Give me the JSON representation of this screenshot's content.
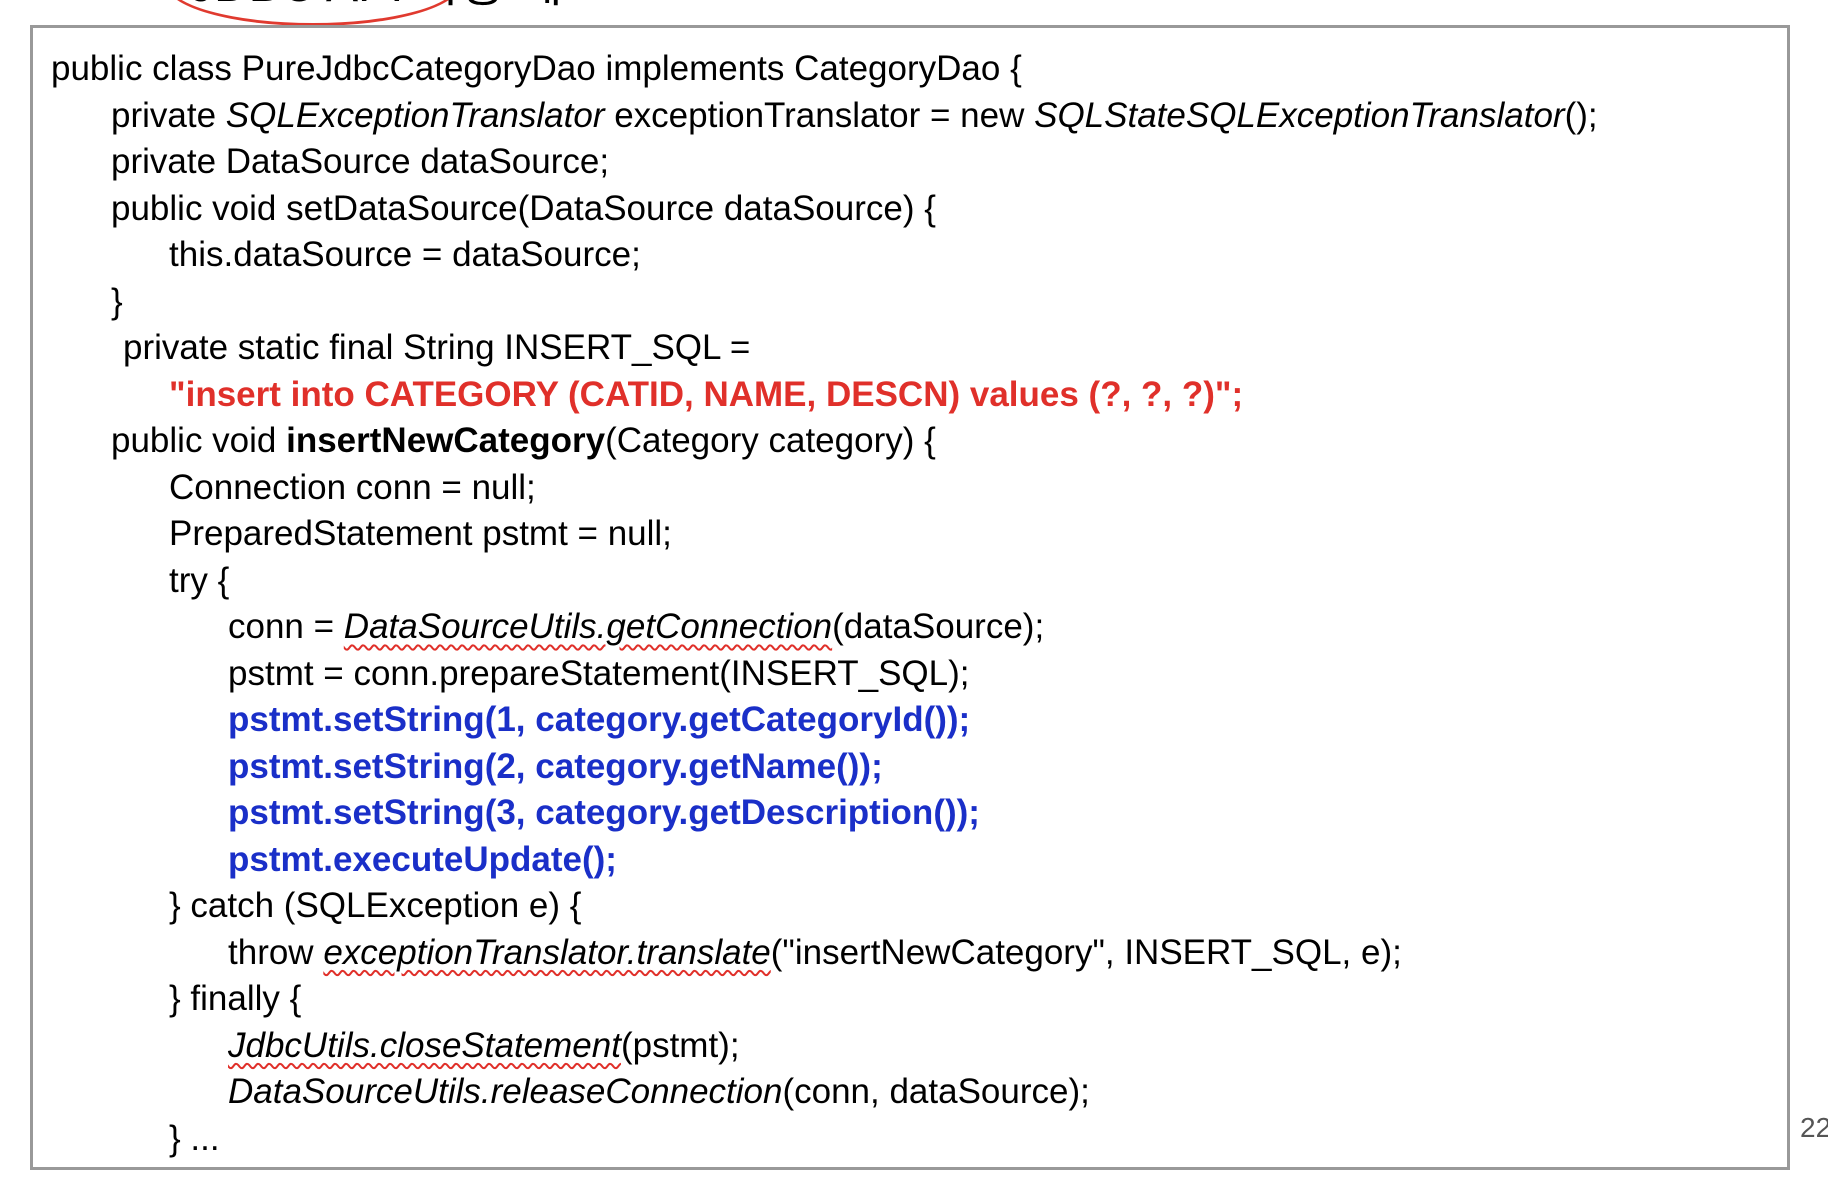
{
  "slide": {
    "title": "JDBC API 사용 예",
    "page_number": "22"
  },
  "code": {
    "l1": "public class PureJdbcCategoryDao implements CategoryDao {",
    "l2_a": "private ",
    "l2_b": "SQLExceptionTranslator",
    "l2_c": " exceptionTranslator = new ",
    "l2_d": "SQLStateSQLExceptionTranslator",
    "l2_e": "();",
    "l3": "private DataSource dataSource;",
    "l4": "public void setDataSource(DataSource dataSource) {",
    "l5": "this.dataSource = dataSource;",
    "l6": "}",
    "l7": "private static final String INSERT_SQL =",
    "l8": "\"insert into CATEGORY (CATID, NAME, DESCN) values (?, ?, ?)\";",
    "l9_a": "public void ",
    "l9_b": "insertNewCategory",
    "l9_c": "(Category category) {",
    "l10": "Connection conn = null;",
    "l11": "PreparedStatement pstmt = null;",
    "l12": "try {",
    "l13_a": "conn = ",
    "l13_b": "DataSourceUtils.getConnection",
    "l13_c": "(dataSource);",
    "l14": "pstmt = conn.prepareStatement(INSERT_SQL);",
    "l15": "pstmt.setString(1, category.getCategoryId());",
    "l16": "pstmt.setString(2, category.getName());",
    "l17": "pstmt.setString(3, category.getDescription());",
    "l18": "pstmt.executeUpdate();",
    "l19": "} catch (SQLException e) {",
    "l20_a": "throw ",
    "l20_b": "exceptionTranslator.translate",
    "l20_c": "(\"insertNewCategory\", INSERT_SQL, e);",
    "l21": "} finally {",
    "l22_a": "JdbcUtils.closeStatement",
    "l22_b": "(pstmt);",
    "l23_a": "DataSourceUtils.releaseConnection",
    "l23_b": "(conn, dataSource);",
    "l24": "} ..."
  },
  "colors": {
    "sql_string": "#e0302a",
    "highlight_calls": "#1a2fc8",
    "annotation": "#e0302a",
    "frame_border": "#999999"
  }
}
